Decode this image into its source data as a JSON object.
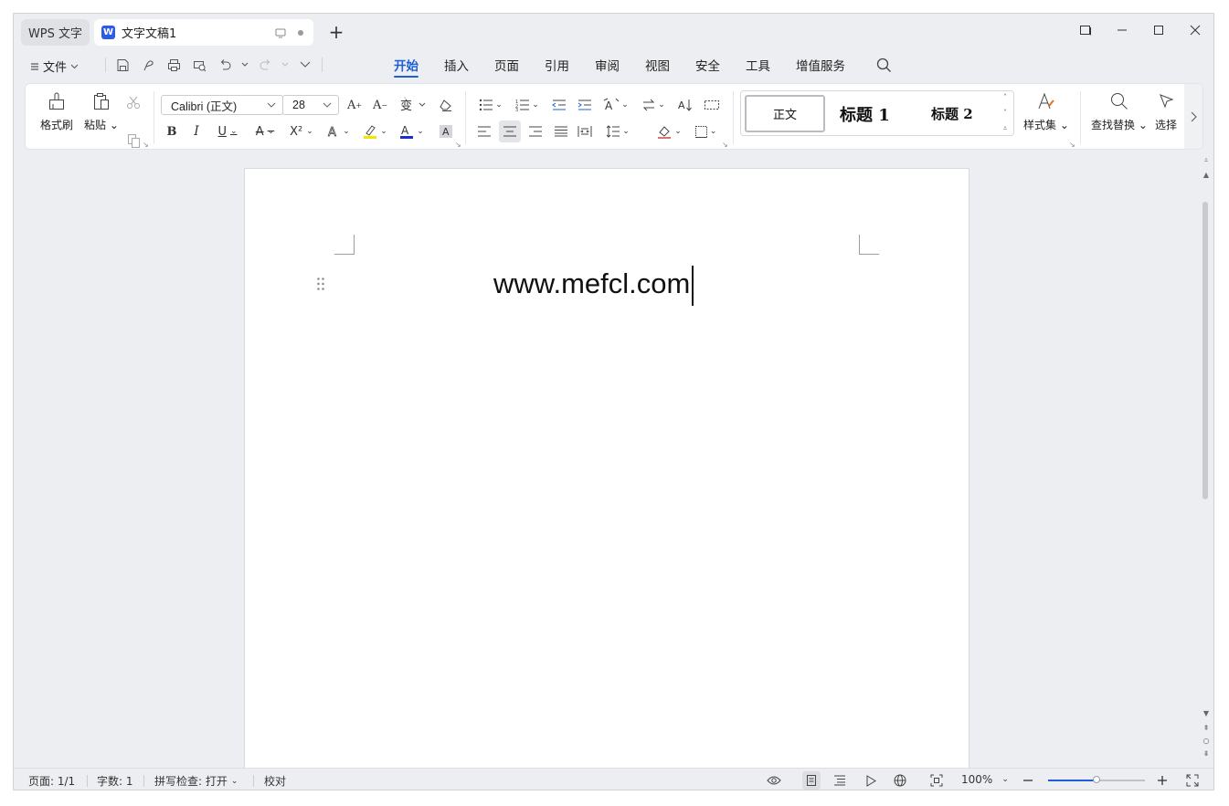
{
  "titlebar": {
    "home_tab": "WPS 文字",
    "doc_badge": "W",
    "doc_title": "文字文稿1",
    "add_tab": "+"
  },
  "menu": {
    "file_label": "文件",
    "tabs": [
      "开始",
      "插入",
      "页面",
      "引用",
      "审阅",
      "视图",
      "安全",
      "工具",
      "增值服务"
    ],
    "active_tab": "开始"
  },
  "ribbon": {
    "format_painter": "格式刷",
    "paste": "粘贴",
    "font_name": "Calibri (正文)",
    "font_size": "28",
    "styles": {
      "normal": "正文",
      "heading1": "标题 1",
      "heading2": "标题 2"
    },
    "style_set": "样式集",
    "find_replace": "查找替换",
    "select": "选择"
  },
  "document": {
    "text": "www.mefcl.com"
  },
  "statusbar": {
    "page": "页面: 1/1",
    "words": "字数: 1",
    "spellcheck": "拼写检查: 打开",
    "proofread": "校对",
    "zoom": "100%",
    "zoom_level": 0.5
  },
  "colors": {
    "accent": "#1c5fd6",
    "doc_badge": "#2b5ce7",
    "highlight": "#f2e600",
    "font_color": "#1a2fd0"
  }
}
